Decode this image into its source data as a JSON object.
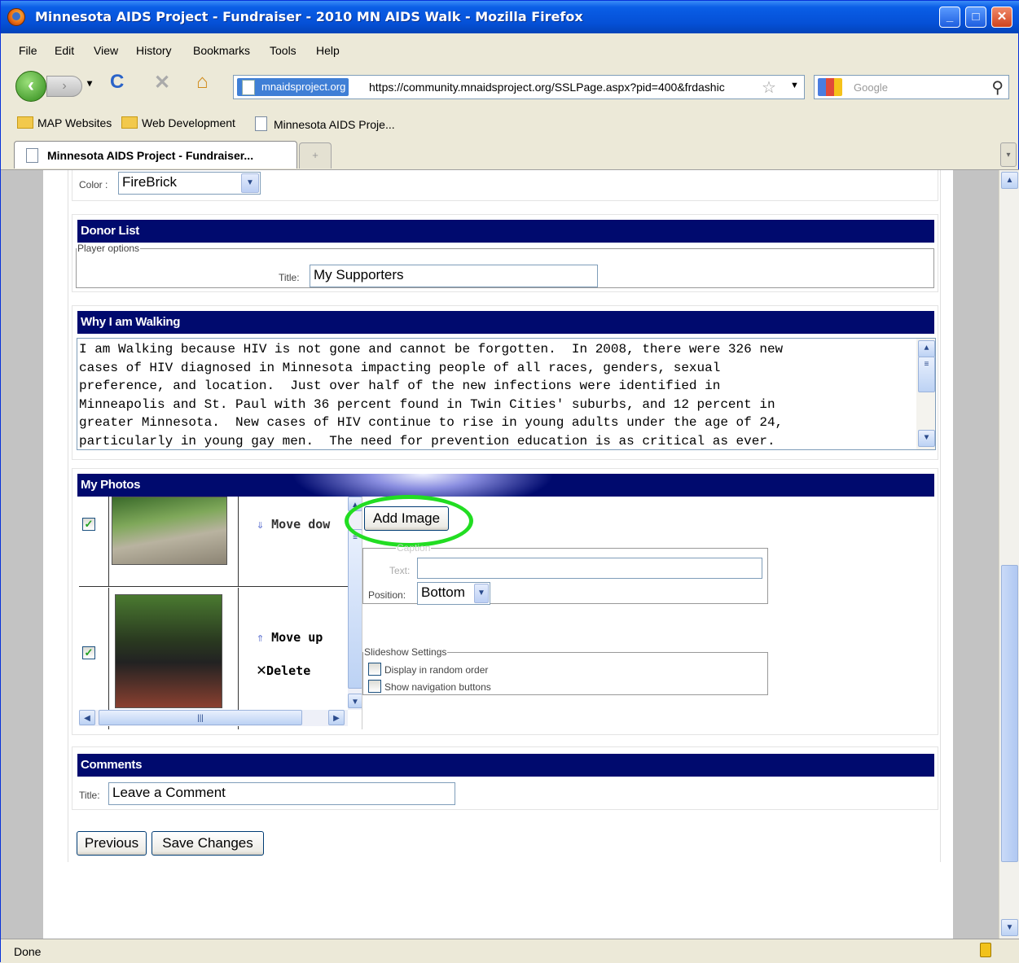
{
  "window": {
    "title": "Minnesota AIDS Project - Fundraiser - 2010 MN AIDS Walk - Mozilla Firefox"
  },
  "menu": [
    "File",
    "Edit",
    "View",
    "History",
    "Bookmarks",
    "Tools",
    "Help"
  ],
  "nav": {
    "site_badge": "mnaidsproject.org",
    "url": "https://community.mnaidsproject.org/SSLPage.aspx?pid=400&frdashic",
    "search_placeholder": "Google"
  },
  "bookmarks": [
    "MAP Websites",
    "Web Development",
    "Minnesota AIDS Proje..."
  ],
  "tab": {
    "label": "Minnesota AIDS Project - Fundraiser..."
  },
  "color_row": {
    "label": "Color :",
    "value": "FireBrick"
  },
  "donor_list": {
    "header": "Donor List",
    "legend": "Player options",
    "title_label": "Title:",
    "title_value": "My Supporters"
  },
  "why_walking": {
    "header": "Why I am Walking",
    "lines": [
      "I am Walking because HIV is not gone and cannot be forgotten.  In 2008, there were 326 new",
      "cases of HIV diagnosed in Minnesota impacting people of all races, genders, sexual",
      "preference, and location.  Just over half of the new infections were identified in",
      "Minneapolis and St. Paul with 36 percent found in Twin Cities' suburbs, and 12 percent in",
      "greater Minnesota.  New cases of HIV continue to rise in young adults under the age of 24,",
      "particularly in young gay men.  The need for prevention education is as critical as ever."
    ]
  },
  "photos": {
    "header": "My Photos",
    "move_down": "Move dow",
    "move_up": "Move up",
    "delete": "Delete",
    "add_image": "Add Image",
    "caption_legend": "Caption",
    "text_label": "Text:",
    "position_label": "Position:",
    "position_value": "Bottom",
    "slideshow_legend": "Slideshow Settings",
    "random_order": "Display in random order",
    "nav_buttons": "Show navigation buttons"
  },
  "comments": {
    "header": "Comments",
    "title_label": "Title:",
    "title_value": "Leave a Comment"
  },
  "buttons": {
    "previous": "Previous",
    "save": "Save Changes"
  },
  "status": {
    "text": "Done"
  },
  "colors": {
    "section_header": "#000a6e",
    "highlight_ring": "#22dd22"
  }
}
